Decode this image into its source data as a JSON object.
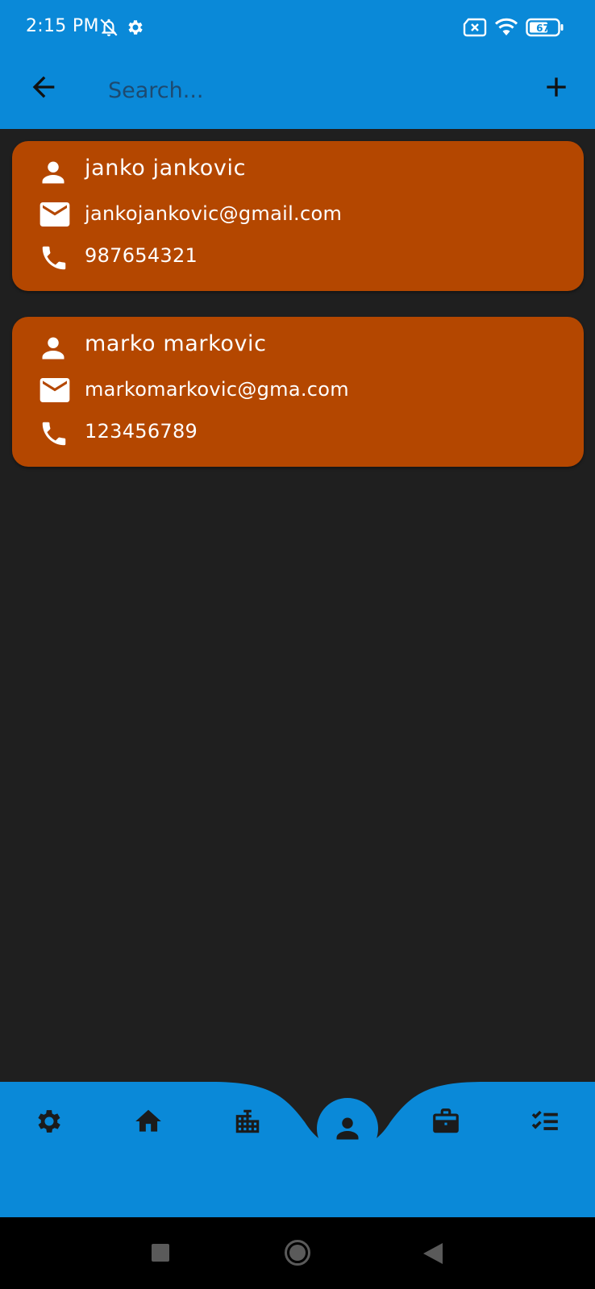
{
  "status_bar": {
    "time": "2:15 PM",
    "battery": "67",
    "icons": [
      "bell-off-icon",
      "gear-icon",
      "no-sim-icon",
      "wifi-icon",
      "battery-icon"
    ]
  },
  "app_bar": {
    "back_icon": "arrow-left-icon",
    "search": {
      "placeholder": "Search...",
      "value": ""
    },
    "add_icon": "plus-icon"
  },
  "contacts": [
    {
      "name": "janko jankovic",
      "email": "jankojankovic@gmail.com",
      "phone": "987654321"
    },
    {
      "name": "marko markovic",
      "email": "markomarkovic@gma.com",
      "phone": "123456789"
    }
  ],
  "bottom_nav": {
    "items": [
      "gear-icon",
      "home-icon",
      "building-icon",
      "person-icon",
      "briefcase-icon",
      "checklist-icon"
    ],
    "active": "person-icon"
  },
  "system_nav": {
    "buttons": [
      "square-icon",
      "circle-icon",
      "triangle-back-icon"
    ]
  },
  "colors": {
    "primary": "#0a89d8",
    "card": "#b44700",
    "background": "#1f1f1f",
    "text_on_card": "#ffffff"
  }
}
